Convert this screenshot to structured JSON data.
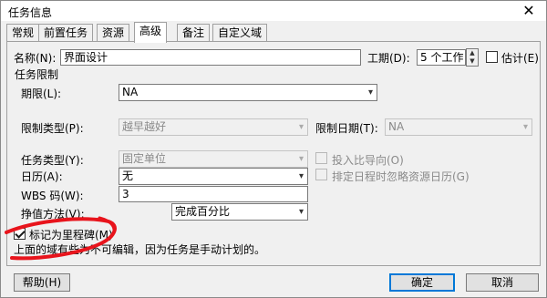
{
  "dialog": {
    "title": "任务信息",
    "close_glyph": "✕"
  },
  "tabs": [
    {
      "label": "常规"
    },
    {
      "label": "前置任务"
    },
    {
      "label": "资源"
    },
    {
      "label": "高级",
      "active": true
    },
    {
      "label": "备注"
    },
    {
      "label": "自定义域"
    }
  ],
  "name": {
    "label": "名称(N):",
    "value": "界面设计"
  },
  "duration": {
    "label": "工期(D):",
    "value": "5 个工作",
    "estimated_label": "估计(E)",
    "estimated": false
  },
  "constraints": {
    "section_label": "任务限制",
    "deadline_label": "期限(L):",
    "deadline_value": "NA",
    "type_label": "限制类型(P):",
    "type_value": "越早越好",
    "date_label": "限制日期(T):",
    "date_value": "NA"
  },
  "task_type": {
    "label": "任务类型(Y):",
    "value": "固定单位"
  },
  "effort_driven": {
    "label": "投入比导向(O)",
    "checked": false
  },
  "calendar": {
    "label": "日历(A):",
    "value": "无"
  },
  "ignore_calendars": {
    "label": "排定日程时忽略资源日历(G)",
    "checked": false
  },
  "wbs": {
    "label": "WBS 码(W):",
    "value": "3"
  },
  "earned_value": {
    "label": "挣值方法(V):",
    "value": "完成百分比"
  },
  "milestone": {
    "label": "标记为里程碑(M)",
    "checked": true
  },
  "note": "上面的域有些为不可编辑，因为任务是手动计划的。",
  "buttons": {
    "help": "帮助(H)",
    "ok": "确定",
    "cancel": "取消"
  },
  "colors": {
    "annotation": "#e8141c",
    "accent": "#0078d7"
  },
  "icons": {
    "dropdown": "▾",
    "spin_up": "▲",
    "spin_down": "▼"
  }
}
